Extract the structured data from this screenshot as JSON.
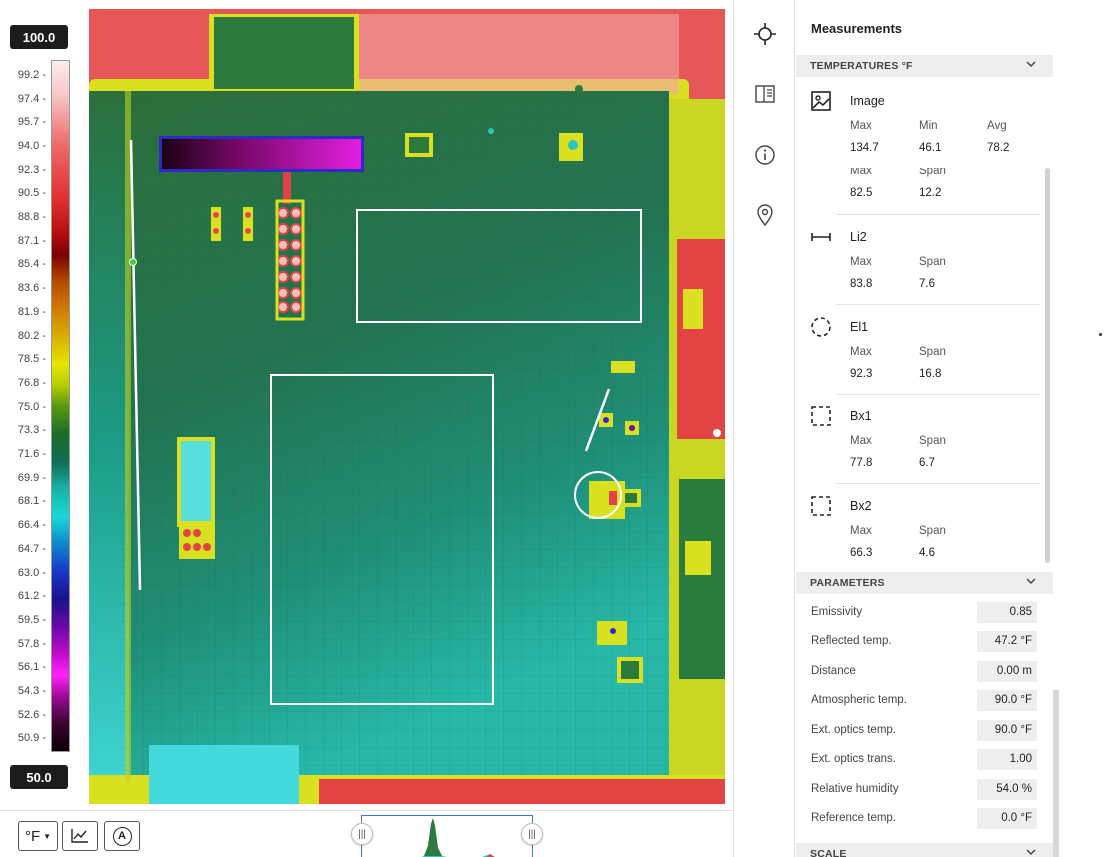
{
  "scale": {
    "max": "100.0",
    "min": "50.0",
    "ticks": [
      "99.2 -",
      "97.4 -",
      "95.7 -",
      "94.0 -",
      "92.3 -",
      "90.5 -",
      "88.8 -",
      "87.1 -",
      "85.4 -",
      "83.6 -",
      "81.9 -",
      "80.2 -",
      "78.5 -",
      "76.8 -",
      "75.0 -",
      "73.3 -",
      "71.6 -",
      "69.9 -",
      "68.1 -",
      "66.4 -",
      "64.7 -",
      "63.0 -",
      "61.2 -",
      "59.5 -",
      "57.8 -",
      "56.1 -",
      "54.3 -",
      "52.6 -",
      "50.9 -"
    ]
  },
  "toolbar": {
    "unit_label": "°F",
    "chart_icon": "chart-icon",
    "auto_label": "A"
  },
  "rail": {
    "icons": [
      "crosshair-icon",
      "compare-icon",
      "info-icon",
      "location-pin-icon"
    ]
  },
  "panel": {
    "title": "Measurements",
    "temperatures_header": "TEMPERATURES °F",
    "image": {
      "name": "Image",
      "labels": [
        "Max",
        "Min",
        "Avg"
      ],
      "values": [
        "134.7",
        "46.1",
        "78.2"
      ]
    },
    "partial": {
      "labels": [
        "Max",
        "Span"
      ],
      "values": [
        "82.5",
        "12.2"
      ]
    },
    "measurements": [
      {
        "name": "Li2",
        "icon": "line-tool-icon",
        "labels": [
          "Max",
          "Span"
        ],
        "values": [
          "83.8",
          "7.6"
        ]
      },
      {
        "name": "El1",
        "icon": "ellipse-tool-icon",
        "labels": [
          "Max",
          "Span"
        ],
        "values": [
          "92.3",
          "16.8"
        ]
      },
      {
        "name": "Bx1",
        "icon": "box-tool-icon",
        "labels": [
          "Max",
          "Span"
        ],
        "values": [
          "77.8",
          "6.7"
        ]
      },
      {
        "name": "Bx2",
        "icon": "box-tool-icon",
        "labels": [
          "Max",
          "Span"
        ],
        "values": [
          "66.3",
          "4.6"
        ]
      }
    ],
    "parameters_header": "PARAMETERS",
    "parameters": [
      {
        "label": "Emissivity",
        "value": "0.85"
      },
      {
        "label": "Reflected temp.",
        "value": "47.2 °F"
      },
      {
        "label": "Distance",
        "value": "0.00 m"
      },
      {
        "label": "Atmospheric temp.",
        "value": "90.0 °F"
      },
      {
        "label": "Ext. optics temp.",
        "value": "90.0 °F"
      },
      {
        "label": "Ext. optics trans.",
        "value": "1.00"
      },
      {
        "label": "Relative humidity",
        "value": "54.0 %"
      },
      {
        "label": "Reference temp.",
        "value": "0.0 °F"
      }
    ],
    "scale_header": "SCALE"
  },
  "colors": {
    "hot": "#e03b3b",
    "warm": "#d8e020",
    "mid": "#2e7d3a",
    "cool": "#27c6c0",
    "accent": "#3a7bd5"
  }
}
